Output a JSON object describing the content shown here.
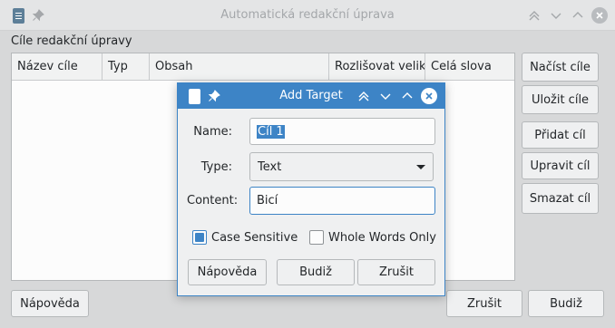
{
  "main_window": {
    "title": "Automatická redakční úprava",
    "section_label": "Cíle redakční úpravy",
    "columns": [
      "Název cíle",
      "Typ",
      "Obsah",
      "Rozlišovat veliko",
      "Celá slova"
    ],
    "side_buttons": [
      "Načíst cíle",
      "Uložit cíle",
      "Přidat cíl",
      "Upravit cíl",
      "Smazat cíl"
    ],
    "help_label": "Nápověda",
    "cancel_label": "Zrušit",
    "ok_label": "Budiž"
  },
  "dialog": {
    "title": "Add Target",
    "name_label": "Name:",
    "name_value": "Cíl 1",
    "type_label": "Type:",
    "type_value": "Text",
    "content_label": "Content:",
    "content_value": "Bicí",
    "case_sensitive_label": "Case Sensitive",
    "case_sensitive_checked": true,
    "whole_words_label": "Whole Words Only",
    "whole_words_checked": false,
    "help_label": "Nápověda",
    "ok_label": "Budiž",
    "cancel_label": "Zrušit"
  },
  "colors": {
    "accent": "#3d84c6",
    "window_bg": "#eff0f1",
    "inactive_title": "#a4a7aa"
  },
  "icons": [
    "document-icon",
    "pin-icon",
    "keep-above-icon",
    "minimize-icon",
    "maximize-icon",
    "close-icon"
  ]
}
